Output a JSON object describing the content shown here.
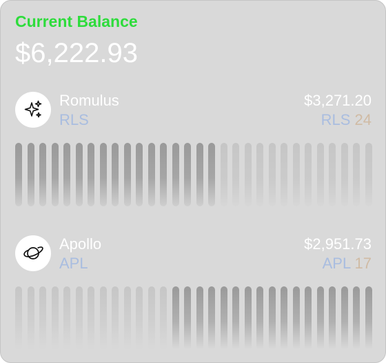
{
  "header": {
    "title": "Current Balance",
    "balance": "$6,222.93"
  },
  "colors": {
    "title": "#2edc3c",
    "ticker": "#a9bde0",
    "quantity": "#d0bba4",
    "bar_filled": "#9a9a9a",
    "bar_empty": "#c6c6c6"
  },
  "assets": [
    {
      "name": "Romulus",
      "ticker": "RLS",
      "value": "$3,271.20",
      "holding_ticker": "RLS",
      "quantity": "24",
      "icon": "sparkles-icon",
      "bar_count": 30,
      "filled_bars": 17,
      "filled_side": "left"
    },
    {
      "name": "Apollo",
      "ticker": "APL",
      "value": "$2,951.73",
      "holding_ticker": "APL",
      "quantity": "17",
      "icon": "planet-icon",
      "bar_count": 30,
      "filled_bars": 17,
      "filled_side": "right"
    }
  ]
}
